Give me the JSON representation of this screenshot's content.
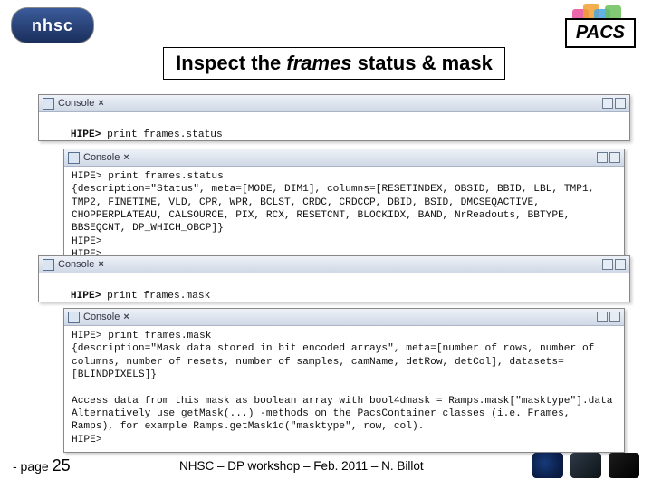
{
  "header": {
    "nhsc_logo_text": "nhsc",
    "pacs_label": "PACS"
  },
  "title": {
    "prefix": "Inspect the ",
    "emphasis": "frames",
    "suffix": " status & mask"
  },
  "commands": {
    "status": {
      "prompt": "HIPE>",
      "text": " print frames.status"
    },
    "mask": {
      "prompt": "HIPE>",
      "text": " print frames.mask"
    }
  },
  "console": {
    "tab_label": "Console",
    "status_output": "HIPE> print frames.status\n{description=\"Status\", meta=[MODE, DIM1], columns=[RESETINDEX, OBSID, BBID, LBL, TMP1, TMP2, FINETIME, VLD, CPR, WPR, BCLST, CRDC, CRDCCP, DBID, BSID, DMCSEQACTIVE, CHOPPERPLATEAU, CALSOURCE, PIX, RCX, RESETCNT, BLOCKIDX, BAND, NrReadouts, BBTYPE, BBSEQCNT, DP_WHICH_OBCP]}\nHIPE>\nHIPE>",
    "mask_output": "HIPE> print frames.mask\n{description=\"Mask data stored in bit encoded arrays\", meta=[number of rows, number of columns, number of resets, number of samples, camName, detRow, detCol], datasets=[BLINDPIXELS]}\n\nAccess data from this mask as boolean array with bool4dmask = Ramps.mask[\"masktype\"].data\nAlternatively use getMask(...) -methods on the PacsContainer classes (i.e. Frames, Ramps), for example Ramps.getMask1d(\"masktype\", row, col).\nHIPE>"
  },
  "footer": {
    "page_prefix": "- page ",
    "page_number": "25",
    "center_text": "NHSC – DP workshop – Feb. 2011 – N. Billot"
  }
}
